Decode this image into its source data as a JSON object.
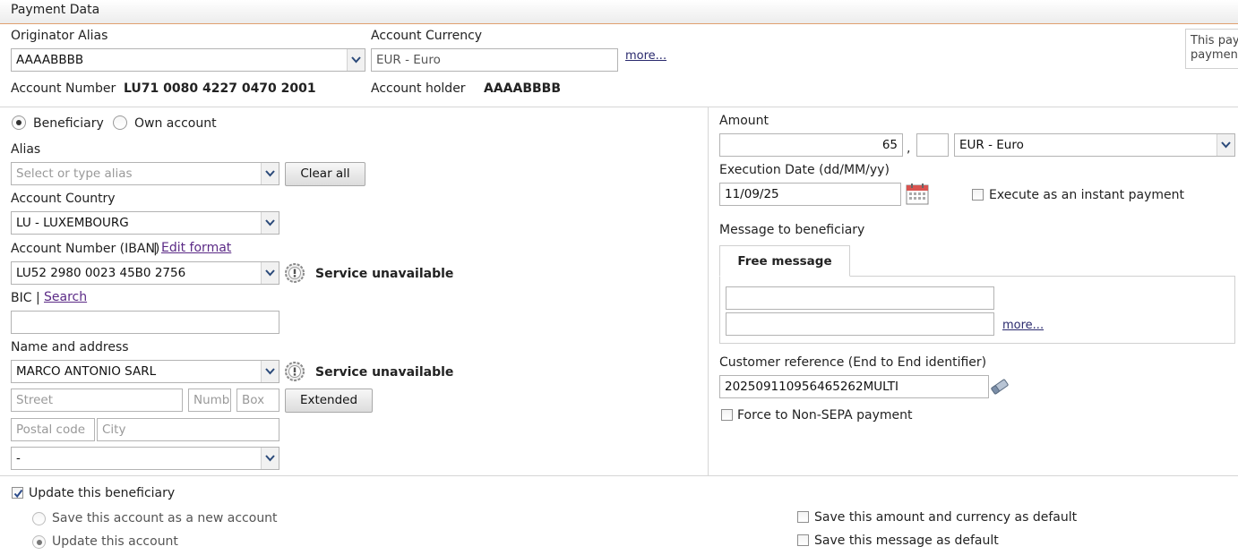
{
  "section": {
    "title": "Payment Data"
  },
  "originator": {
    "alias_label": "Originator Alias",
    "alias_value": "AAAABBBB",
    "currency_label": "Account Currency",
    "currency_value": "EUR - Euro",
    "more_link": "more...",
    "account_number_label": "Account Number",
    "account_number_value": "LU71 0080 4227 0470 2001",
    "holder_label": "Account holder",
    "holder_value": "AAAABBBB",
    "side_note_line1": "This pay",
    "side_note_line2": "paymen"
  },
  "beneficiary": {
    "type_beneficiary": "Beneficiary",
    "type_own": "Own account",
    "alias_label": "Alias",
    "alias_placeholder": "Select or type alias",
    "clear_all": "Clear all",
    "country_label": "Account Country",
    "country_value": "LU - LUXEMBOURG",
    "iban_label": "Account Number (IBAN)",
    "iban_sep": "|",
    "edit_format": "Edit format",
    "iban_value": "LU52 2980 0023 45B0 2756",
    "service_unavailable": "Service unavailable",
    "bic_label": "BIC",
    "bic_sep": "|",
    "bic_search": "Search",
    "name_label": "Name and address",
    "name_value": "MARCO ANTONIO SARL",
    "street_ph": "Street",
    "number_ph": "Number",
    "box_ph": "Box",
    "extended": "Extended",
    "postal_ph": "Postal code",
    "city_ph": "City",
    "country2_value": "-"
  },
  "payment": {
    "amount_label": "Amount",
    "amount_value": "65",
    "decimal_sep": ",",
    "decimals_value": "",
    "currency_value": "EUR - Euro",
    "date_label": "Execution Date (dd/MM/yy)",
    "date_value": "11/09/25",
    "instant_label": "Execute as an instant payment",
    "message_label": "Message to beneficiary",
    "free_message_tab": "Free message",
    "more_link": "more...",
    "customer_ref_label": "Customer reference (End to End identifier)",
    "customer_ref_value": "20250911095646​5262MULTI",
    "force_nonsepa": "Force to Non-SEPA payment"
  },
  "footer": {
    "update_beneficiary": "Update this beneficiary",
    "save_new": "Save this account as a new account",
    "update_account": "Update this account",
    "save_amount_default": "Save this amount and currency as default",
    "save_message_default": "Save this message as default"
  }
}
